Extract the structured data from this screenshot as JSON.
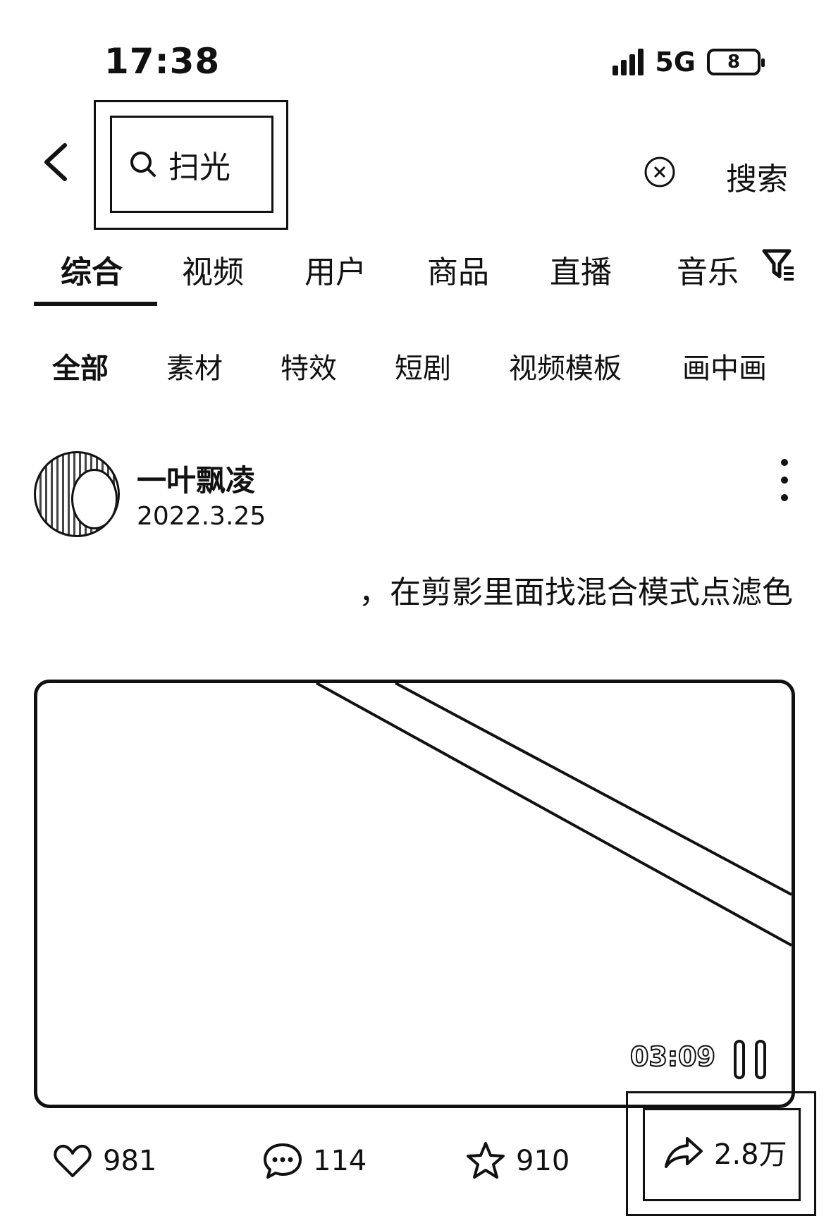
{
  "status_bar": {
    "time": "17:38",
    "network": "5G",
    "battery": "8"
  },
  "search": {
    "query": "扫光",
    "submit_label": "搜索"
  },
  "tabs": [
    {
      "label": "综合",
      "active": true
    },
    {
      "label": "视频"
    },
    {
      "label": "用户"
    },
    {
      "label": "商品"
    },
    {
      "label": "直播"
    },
    {
      "label": "音乐"
    }
  ],
  "subtabs": [
    {
      "label": "全部",
      "active": true
    },
    {
      "label": "素材"
    },
    {
      "label": "特效"
    },
    {
      "label": "短剧"
    },
    {
      "label": "视频模板"
    },
    {
      "label": "画中画"
    }
  ],
  "post": {
    "author": "一叶飘凌",
    "date": "2022.3.25",
    "caption": "，在剪影里面找混合模式点滤色",
    "video_duration": "03:09",
    "likes": "981",
    "comments": "114",
    "favorites": "910",
    "shares": "2.8万"
  },
  "icons": {
    "back": "back-icon",
    "search": "search-icon",
    "clear": "clear-icon",
    "filter": "filter-icon",
    "more": "more-icon",
    "pause": "pause-icon",
    "like": "heart-icon",
    "comment": "comment-icon",
    "favorite": "star-icon",
    "share": "share-icon"
  }
}
